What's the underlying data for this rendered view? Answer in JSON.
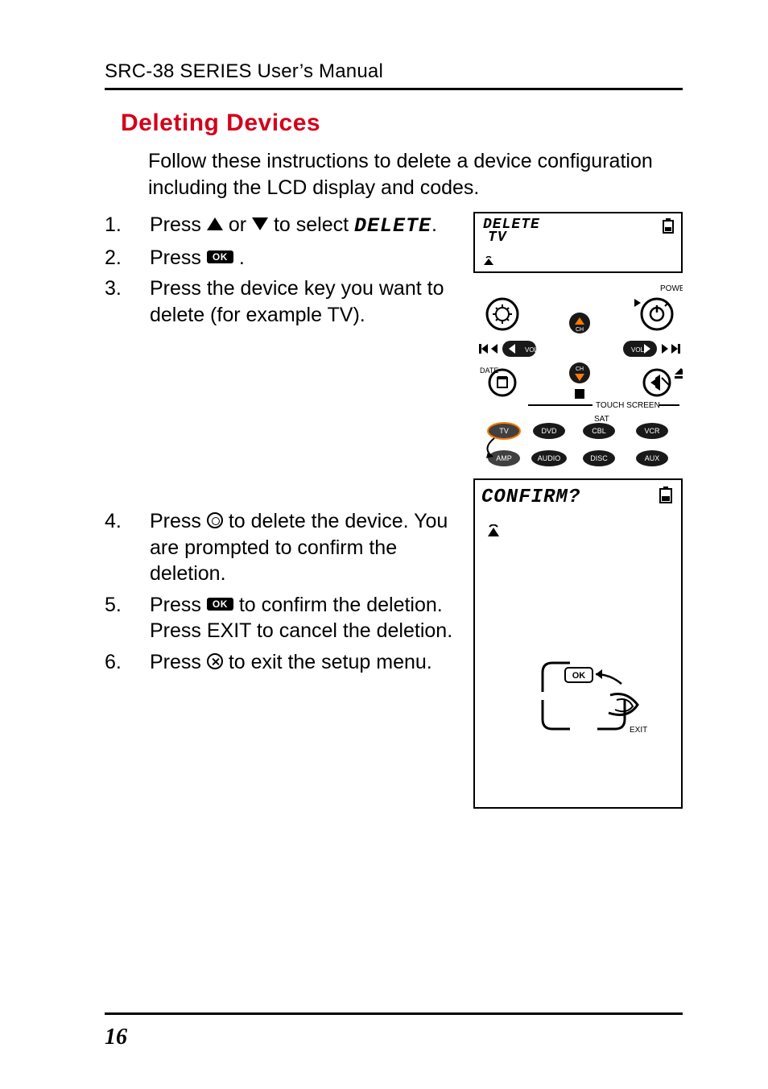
{
  "header": {
    "running": "SRC-38 SERIES User’s Manual"
  },
  "section": {
    "title": "Deleting Devices"
  },
  "intro": "Follow these instructions to delete a device configuration including the LCD display and codes.",
  "steps": {
    "s1a": "Press ",
    "s1b": " or ",
    "s1c": " to select ",
    "s1d": "DELETE",
    "s1e": ".",
    "s2a": "Press ",
    "s2b": ".",
    "s3": "Press the device key you want to delete (for example TV).",
    "s4a": "Press ",
    "s4b": " to delete the device. You are prompted to confirm the deletion.",
    "s5a": "Press ",
    "s5b": " to confirm the deletion. Press EXIT to cancel the deletion.",
    "s6a": "Press ",
    "s6b": " to exit the setup menu."
  },
  "nums": {
    "n1": "1.",
    "n2": "2.",
    "n3": "3.",
    "n4": "4.",
    "n5": "5.",
    "n6": "6."
  },
  "okLabel": "OK",
  "lcd1": {
    "line1": "DELETE",
    "line2": "TV"
  },
  "lcd2": {
    "line1": "CONFIRM?"
  },
  "remoteLabels": {
    "power": "POWER",
    "date": "DATE",
    "touch": "TOUCH SCREEN",
    "sat": "SAT",
    "tv": "TV",
    "dvd": "DVD",
    "cbl": "CBL",
    "vcr": "VCR",
    "amp": "AMP",
    "audio": "AUDIO",
    "disc": "DISC",
    "aux": "AUX",
    "vol": "VOL",
    "ch": "CH",
    "exit": "EXIT",
    "ok": "OK"
  },
  "icons": {
    "triUp": "triangle-up-icon",
    "triDown": "triangle-down-icon",
    "ok": "ok-pill-icon",
    "ring": "ring-button-icon",
    "close": "close-circle-icon",
    "battery": "battery-icon",
    "tx": "transmit-icon"
  },
  "pageNumber": "16"
}
